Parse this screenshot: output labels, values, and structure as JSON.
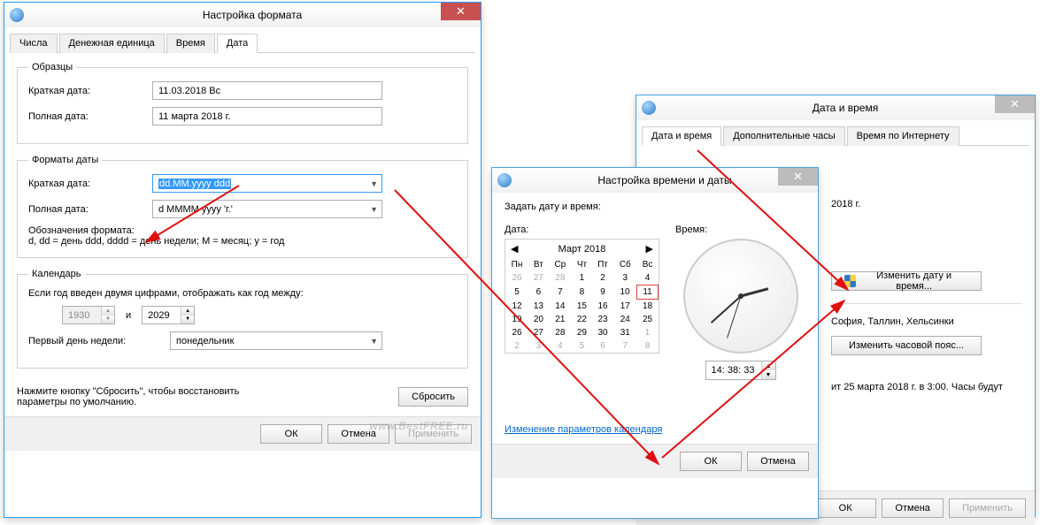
{
  "win_format": {
    "title": "Настройка формата",
    "tabs": [
      "Числа",
      "Денежная единица",
      "Время",
      "Дата"
    ],
    "active_tab": 3,
    "samples": {
      "legend": "Образцы",
      "short_label": "Краткая дата:",
      "short_value": "11.03.2018 Вс",
      "long_label": "Полная дата:",
      "long_value": "11 марта 2018 г."
    },
    "formats": {
      "legend": "Форматы даты",
      "short_label": "Краткая дата:",
      "short_value": "dd.MM.yyyy ddd",
      "long_label": "Полная дата:",
      "long_value": "d MMMM yyyy 'г.'",
      "meaning_label": "Обозначения формата:",
      "meaning_text": "d, dd = день  ddd, dddd = день недели; M = месяц; y = год"
    },
    "calendar": {
      "legend": "Календарь",
      "two_digit_label": "Если год введен двумя цифрами, отображать как год между:",
      "year_from": "1930",
      "and": "и",
      "year_to": "2029",
      "first_day_label": "Первый день недели:",
      "first_day_value": "понедельник"
    },
    "reset_hint": "Нажмите кнопку \"Сбросить\", чтобы восстановить параметры по умолчанию.",
    "reset_btn": "Сбросить",
    "ok": "ОК",
    "cancel": "Отмена",
    "apply": "Применить",
    "watermark": "www.BestFREE.ru"
  },
  "win_settime": {
    "title": "Настройка времени и даты",
    "set_label": "Задать дату и время:",
    "date_label": "Дата:",
    "time_label": "Время:",
    "month": "Март 2018",
    "weekdays": [
      "Пн",
      "Вт",
      "Ср",
      "Чт",
      "Пт",
      "Сб",
      "Вс"
    ],
    "days": [
      [
        {
          "d": "26",
          "o": true
        },
        {
          "d": "27",
          "o": true
        },
        {
          "d": "28",
          "o": true
        },
        {
          "d": "1"
        },
        {
          "d": "2"
        },
        {
          "d": "3"
        },
        {
          "d": "4"
        }
      ],
      [
        {
          "d": "5"
        },
        {
          "d": "6"
        },
        {
          "d": "7"
        },
        {
          "d": "8"
        },
        {
          "d": "9"
        },
        {
          "d": "10"
        },
        {
          "d": "11",
          "sel": true
        }
      ],
      [
        {
          "d": "12"
        },
        {
          "d": "13"
        },
        {
          "d": "14"
        },
        {
          "d": "15"
        },
        {
          "d": "16"
        },
        {
          "d": "17"
        },
        {
          "d": "18"
        }
      ],
      [
        {
          "d": "19"
        },
        {
          "d": "20"
        },
        {
          "d": "21"
        },
        {
          "d": "22"
        },
        {
          "d": "23"
        },
        {
          "d": "24"
        },
        {
          "d": "25"
        }
      ],
      [
        {
          "d": "26"
        },
        {
          "d": "27"
        },
        {
          "d": "28"
        },
        {
          "d": "29"
        },
        {
          "d": "30"
        },
        {
          "d": "31"
        },
        {
          "d": "1",
          "o": true
        }
      ],
      [
        {
          "d": "2",
          "o": true
        },
        {
          "d": "3",
          "o": true
        },
        {
          "d": "4",
          "o": true
        },
        {
          "d": "5",
          "o": true
        },
        {
          "d": "6",
          "o": true
        },
        {
          "d": "7",
          "o": true
        },
        {
          "d": "8",
          "o": true
        }
      ]
    ],
    "time_value": "14: 38: 33",
    "link": "Изменение параметров календаря",
    "ok": "ОК",
    "cancel": "Отмена"
  },
  "win_datetime": {
    "title": "Дата и время",
    "tabs": [
      "Дата и время",
      "Дополнительные часы",
      "Время по Интернету"
    ],
    "active_tab": 0,
    "date_text": "2018 г.",
    "change_btn": "Изменить дату и время...",
    "tz_text": "София, Таллин, Хельсинки",
    "change_tz_btn": "Изменить часовой пояс...",
    "dst_text": "ит 25 марта 2018 г. в 3:00. Часы будут",
    "ok": "ОК",
    "cancel": "Отмена",
    "apply": "Применить"
  }
}
